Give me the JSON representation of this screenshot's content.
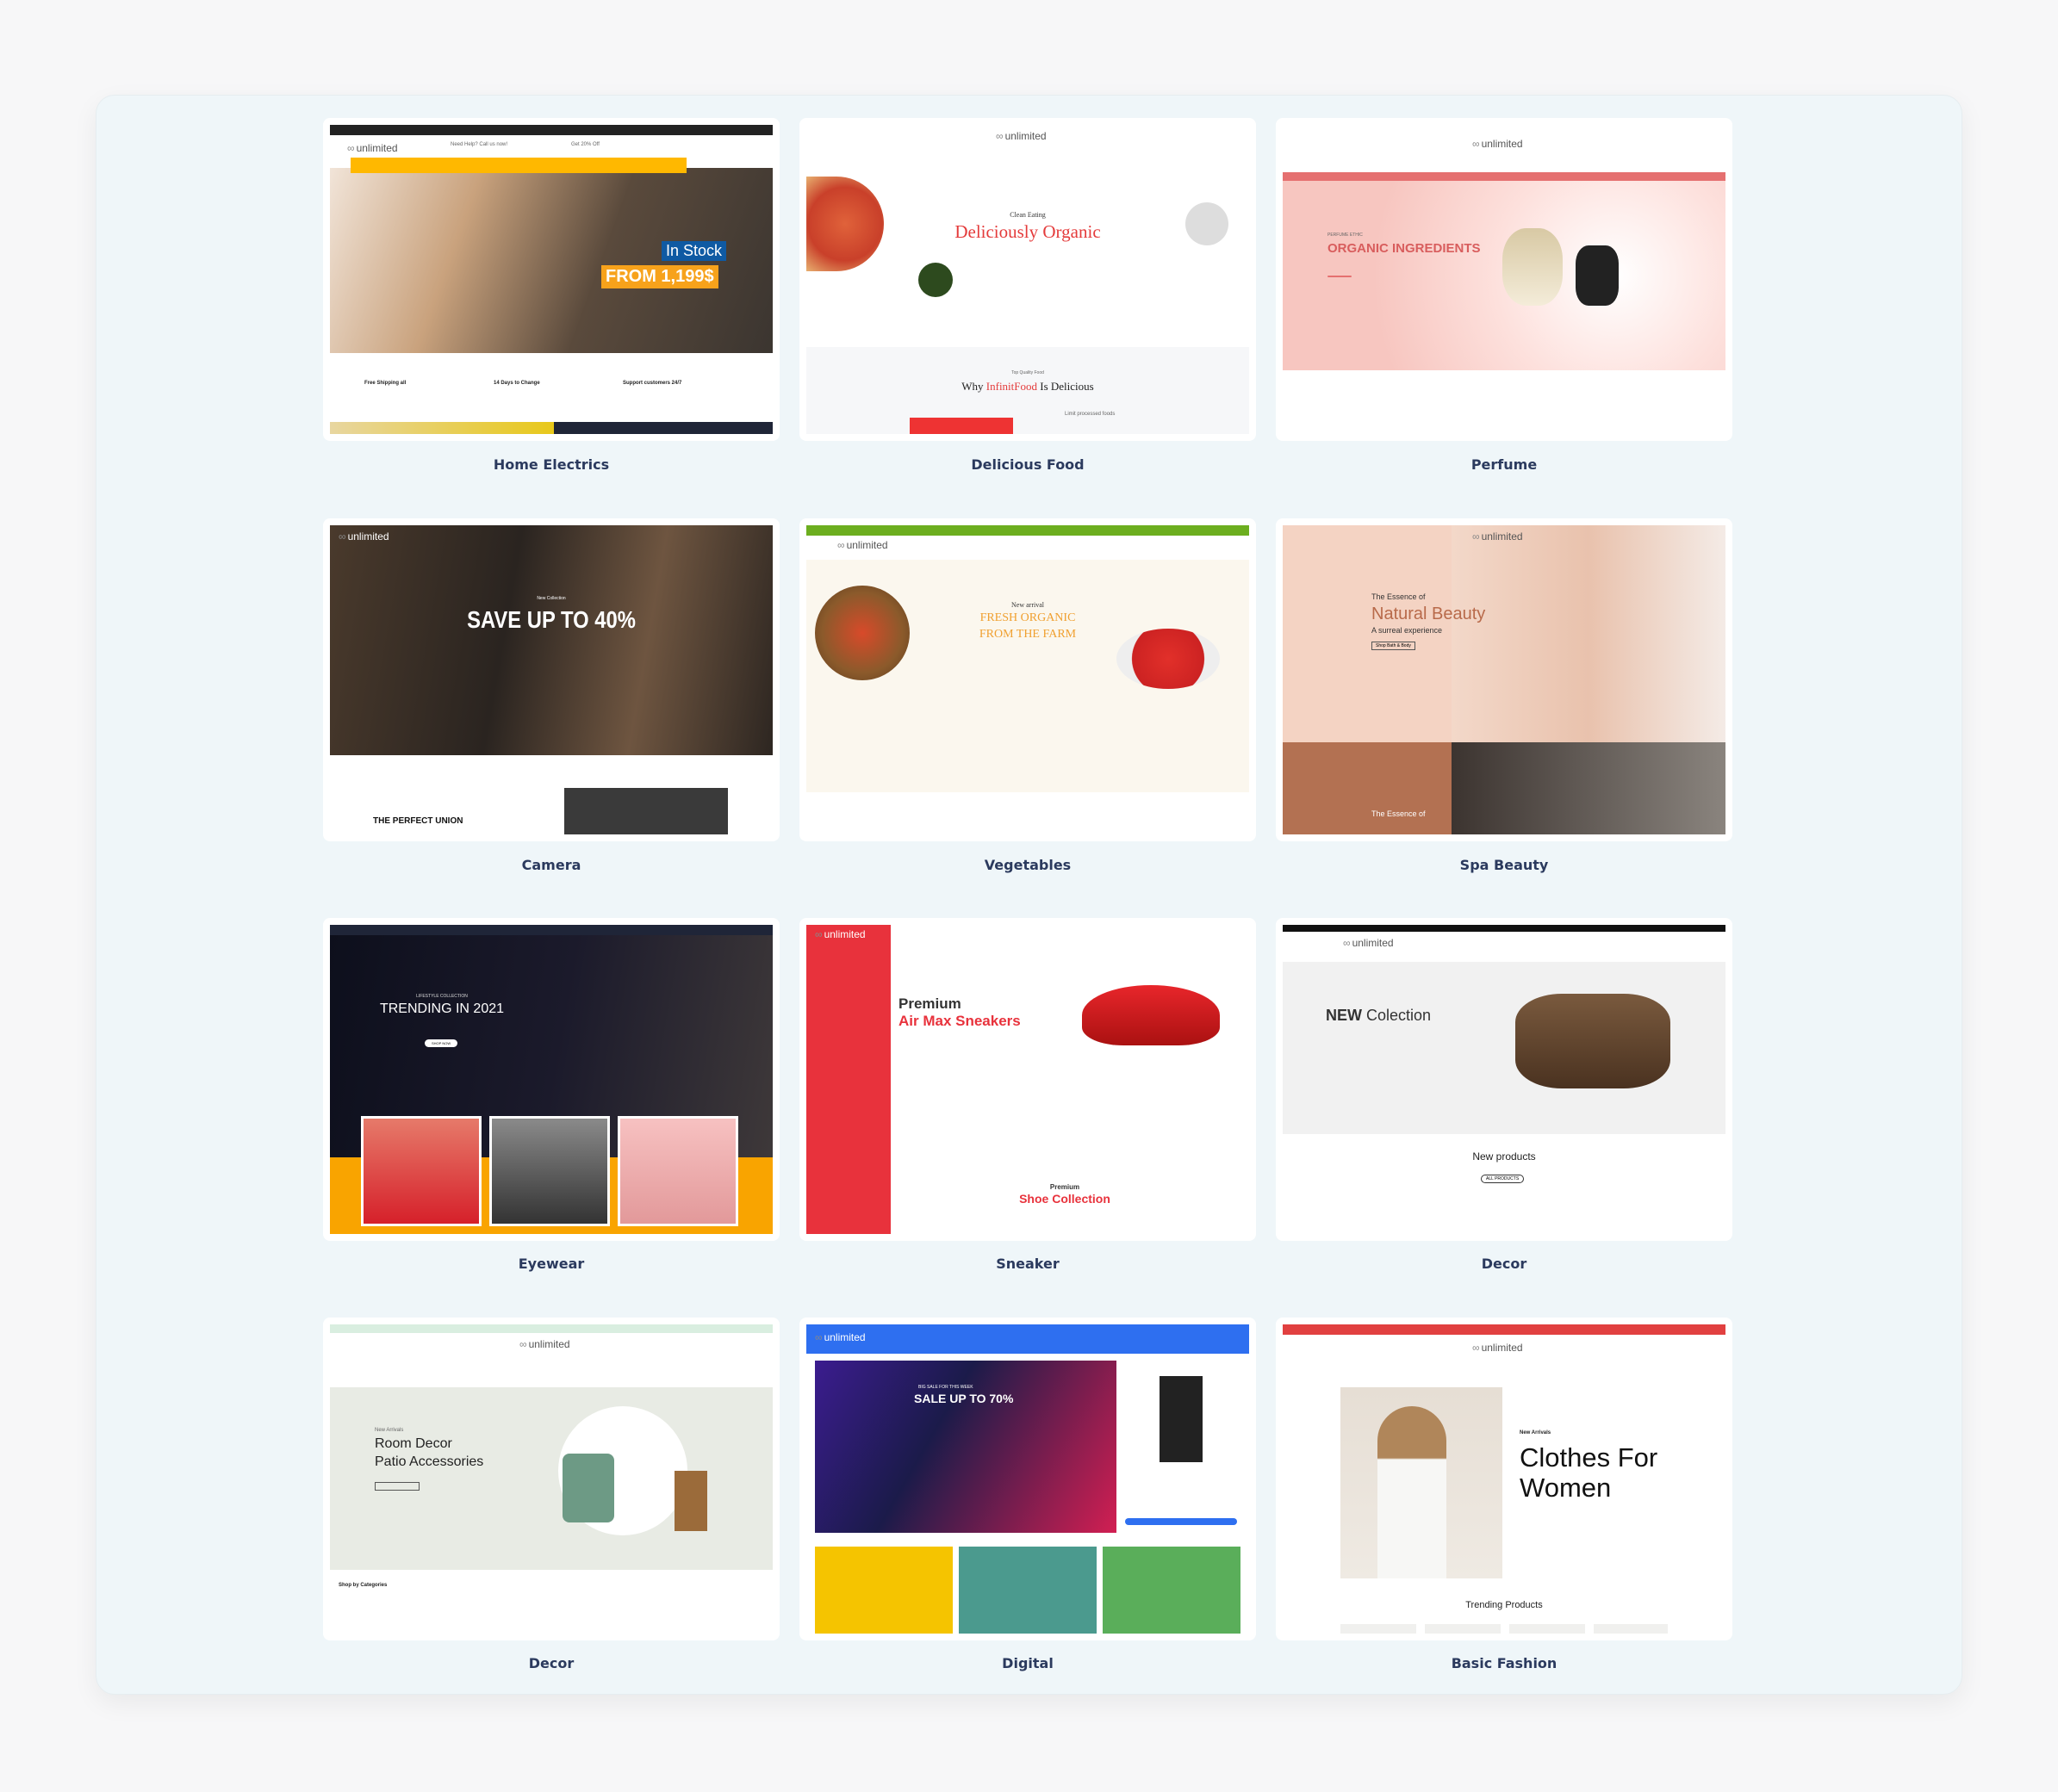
{
  "logo_text": "unlimited",
  "themes": [
    {
      "label": "Home Electrics",
      "badge": "In Stock",
      "price": "FROM 1,199$",
      "features": [
        "Free Shipping all",
        "14 Days to Change",
        "Support customers 24/7"
      ],
      "phone_label": "Need Help? Call us now!",
      "offer_label": "Get 20% Off"
    },
    {
      "label": "Delicious Food",
      "kicker": "Clean Eating",
      "title": "Deliciously Organic",
      "section_kicker": "Top Quality Food",
      "section_title_pre": "Why ",
      "section_title_brand": "InfinitFood",
      "section_title_post": " Is Delicious",
      "feature": "Limit processed foods"
    },
    {
      "label": "Perfume",
      "kicker": "PERFUME ETHIC",
      "title": "ORGANIC INGREDIENTS"
    },
    {
      "label": "Camera",
      "kicker": "New Collection",
      "title": "SAVE UP TO 40%",
      "section_title": "THE PERFECT UNION"
    },
    {
      "label": "Vegetables",
      "kicker": "New arrival",
      "title_line1": "FRESH ORGANIC",
      "title_line2": "FROM THE FARM"
    },
    {
      "label": "Spa Beauty",
      "kicker": "The Essence of",
      "title": "Natural Beauty",
      "subtitle": "A surreal experience",
      "button": "Shop Bath & Body",
      "section_kicker": "The Essence of"
    },
    {
      "label": "Eyewear",
      "kicker": "LIFESTYLE COLLECTION",
      "title": "TRENDING IN 2021",
      "button": "SHOP NOW"
    },
    {
      "label": "Sneaker",
      "kicker": "Premium",
      "title": "Air Max Sneakers",
      "section_kicker": "Premium",
      "section_title": "Shoe Collection"
    },
    {
      "label": "Decor",
      "kicker_bold": "NEW",
      "title": " Colection",
      "section_title": "New products",
      "button": "ALL PRODUCTS"
    },
    {
      "label": "Decor",
      "kicker": "New Arrivals",
      "title_line1": "Room Decor",
      "title_line2": "Patio Accessories",
      "section_title": "Shop by Categories"
    },
    {
      "label": "Digital",
      "kicker": "BIG SALE FOR THIS WEEK",
      "title": "SALE UP TO 70%"
    },
    {
      "label": "Basic Fashion",
      "kicker": "New Arrivals",
      "title_line1": "Clothes For",
      "title_line2": "Women",
      "section_title": "Trending Products"
    }
  ],
  "colors": {
    "label": "#2b3a5e",
    "panel": "#eff6f9",
    "yellow": "#ffb800",
    "red": "#e8323c",
    "blue": "#2e6ff0"
  }
}
